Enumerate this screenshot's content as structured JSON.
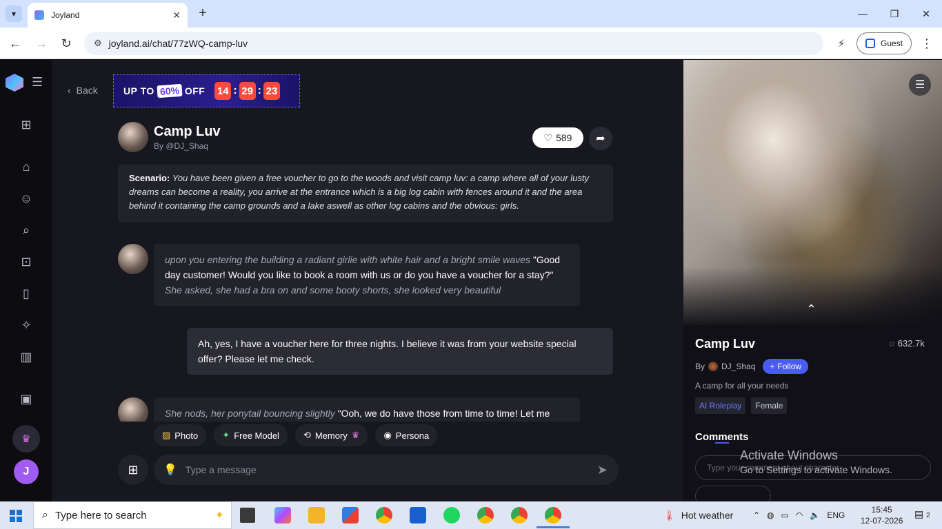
{
  "browser": {
    "tab_title": "Joyland",
    "url": "joyland.ai/chat/77zWQ-camp-luv",
    "profile_label": "Guest"
  },
  "promo": {
    "up_to": "UP TO",
    "percent": "60%",
    "off": "OFF",
    "hours": "14",
    "minutes": "29",
    "seconds": "23"
  },
  "nav": {
    "back_label": "Back"
  },
  "character": {
    "name": "Camp Luv",
    "by": "By @DJ_Shaq",
    "likes": "589"
  },
  "scenario": {
    "label": "Scenario:",
    "text": "You have been given a free voucher to go to the woods and visit camp luv: a camp where all of your lusty dreams can become a reality, you arrive at the entrance which is a big log cabin with fences around it and the area behind it containing the camp grounds and a lake aswell as other log cabins and the obvious: girls."
  },
  "messages": [
    {
      "role": "bot",
      "action_1": "upon you entering the building a radiant girlie with white hair and a bright smile waves",
      "speech": "\"Good day customer! Would you like to book a room with us or do you have a voucher for a stay?\"",
      "action_2": "She asked, she had a bra on and some booty shorts, she looked very beautiful"
    },
    {
      "role": "user",
      "text": "Ah, yes, I have a voucher here for three nights. I believe it was from your website special offer? Please let me check."
    },
    {
      "role": "bot",
      "action_1": "She nods, her ponytail bouncing slightly",
      "speech": "\"Ooh, we do have those from time to time! Let me"
    }
  ],
  "chips": {
    "photo": "Photo",
    "free_model": "Free Model",
    "memory": "Memory",
    "persona": "Persona"
  },
  "composer": {
    "placeholder": "Type a message"
  },
  "panel": {
    "name": "Camp Luv",
    "chat_count": "632.7k",
    "by_label": "By",
    "creator": "DJ_Shaq",
    "follow_label": "Follow",
    "description": "A camp for all your needs",
    "tags": [
      "AI Roleplay",
      "Female"
    ],
    "comments_title": "Comments",
    "comment_placeholder": "Type your comment about character"
  },
  "watermark": {
    "line1": "Activate Windows",
    "line2": "Go to Settings to activate Windows."
  },
  "user": {
    "avatar_letter": "J"
  },
  "taskbar": {
    "search_placeholder": "Type here to search",
    "weather": "Hot weather",
    "language": "ENG",
    "time": "15:45",
    "date": "12-07-2026",
    "notification_count": "2"
  }
}
